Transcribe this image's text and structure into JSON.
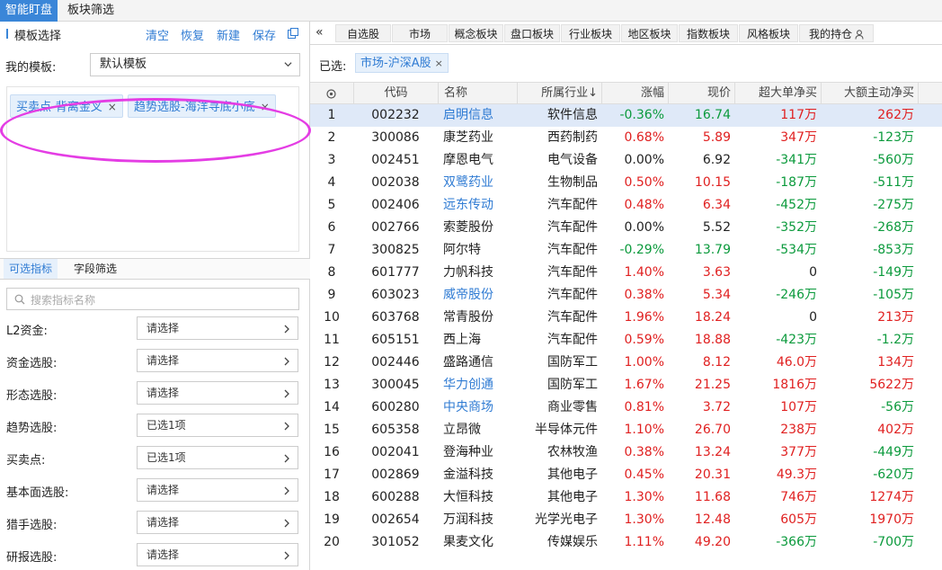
{
  "top_tabs": [
    "智能盯盘",
    "板块筛选"
  ],
  "template": {
    "title": "模板选择",
    "actions": [
      "清空",
      "恢复",
      "新建",
      "保存"
    ],
    "my_template_label": "我的模板:",
    "my_template_value": "默认模板",
    "tags": [
      "买卖点-背离金叉",
      "趋势选股-海洋寻底小底"
    ]
  },
  "sub_tabs": [
    "可选指标",
    "字段筛选"
  ],
  "search": {
    "placeholder": "搜索指标名称"
  },
  "filters": [
    {
      "label": "L2资金:",
      "value": "请选择"
    },
    {
      "label": "资金选股:",
      "value": "请选择"
    },
    {
      "label": "形态选股:",
      "value": "请选择"
    },
    {
      "label": "趋势选股:",
      "value": "已选1项"
    },
    {
      "label": "买卖点:",
      "value": "已选1项"
    },
    {
      "label": "基本面选股:",
      "value": "请选择"
    },
    {
      "label": "猎手选股:",
      "value": "请选择"
    },
    {
      "label": "研报选股:",
      "value": "请选择"
    }
  ],
  "market_tabs": [
    "自选股",
    "市场",
    "概念板块",
    "盘口板块",
    "行业板块",
    "地区板块",
    "指数板块",
    "风格板块",
    "我的持仓"
  ],
  "selected": {
    "label": "已选:",
    "tag": "市场-沪深A股"
  },
  "columns": [
    "代码",
    "名称",
    "所属行业↓",
    "涨幅",
    "现价",
    "超大单净买",
    "大额主动净买"
  ],
  "rows": [
    {
      "idx": "1",
      "code": "002232",
      "name": "启明信息",
      "industry": "软件信息",
      "chg": "-0.36%",
      "price": "16.74",
      "super": "117万",
      "big": "262万",
      "name_link": true,
      "chg_dir": "down",
      "price_dir": "down",
      "super_dir": "up",
      "big_dir": "up"
    },
    {
      "idx": "2",
      "code": "300086",
      "name": "康芝药业",
      "industry": "西药制药",
      "chg": "0.68%",
      "price": "5.89",
      "super": "347万",
      "big": "-123万",
      "name_link": false,
      "chg_dir": "up",
      "price_dir": "up",
      "super_dir": "up",
      "big_dir": "down"
    },
    {
      "idx": "3",
      "code": "002451",
      "name": "摩恩电气",
      "industry": "电气设备",
      "chg": "0.00%",
      "price": "6.92",
      "super": "-341万",
      "big": "-560万",
      "name_link": false,
      "chg_dir": "flat",
      "price_dir": "flat",
      "super_dir": "down",
      "big_dir": "down"
    },
    {
      "idx": "4",
      "code": "002038",
      "name": "双鹭药业",
      "industry": "生物制品",
      "chg": "0.50%",
      "price": "10.15",
      "super": "-187万",
      "big": "-511万",
      "name_link": true,
      "chg_dir": "up",
      "price_dir": "up",
      "super_dir": "down",
      "big_dir": "down"
    },
    {
      "idx": "5",
      "code": "002406",
      "name": "远东传动",
      "industry": "汽车配件",
      "chg": "0.48%",
      "price": "6.34",
      "super": "-452万",
      "big": "-275万",
      "name_link": true,
      "chg_dir": "up",
      "price_dir": "up",
      "super_dir": "down",
      "big_dir": "down"
    },
    {
      "idx": "6",
      "code": "002766",
      "name": "索菱股份",
      "industry": "汽车配件",
      "chg": "0.00%",
      "price": "5.52",
      "super": "-352万",
      "big": "-268万",
      "name_link": false,
      "chg_dir": "flat",
      "price_dir": "flat",
      "super_dir": "down",
      "big_dir": "down"
    },
    {
      "idx": "7",
      "code": "300825",
      "name": "阿尔特",
      "industry": "汽车配件",
      "chg": "-0.29%",
      "price": "13.79",
      "super": "-534万",
      "big": "-853万",
      "name_link": false,
      "chg_dir": "down",
      "price_dir": "down",
      "super_dir": "down",
      "big_dir": "down"
    },
    {
      "idx": "8",
      "code": "601777",
      "name": "力帆科技",
      "industry": "汽车配件",
      "chg": "1.40%",
      "price": "3.63",
      "super": "0",
      "big": "-149万",
      "name_link": false,
      "chg_dir": "up",
      "price_dir": "up",
      "super_dir": "flat",
      "big_dir": "down"
    },
    {
      "idx": "9",
      "code": "603023",
      "name": "威帝股份",
      "industry": "汽车配件",
      "chg": "0.38%",
      "price": "5.34",
      "super": "-246万",
      "big": "-105万",
      "name_link": true,
      "chg_dir": "up",
      "price_dir": "up",
      "super_dir": "down",
      "big_dir": "down"
    },
    {
      "idx": "10",
      "code": "603768",
      "name": "常青股份",
      "industry": "汽车配件",
      "chg": "1.96%",
      "price": "18.24",
      "super": "0",
      "big": "213万",
      "name_link": false,
      "chg_dir": "up",
      "price_dir": "up",
      "super_dir": "flat",
      "big_dir": "up"
    },
    {
      "idx": "11",
      "code": "605151",
      "name": "西上海",
      "industry": "汽车配件",
      "chg": "0.59%",
      "price": "18.88",
      "super": "-423万",
      "big": "-1.2万",
      "name_link": false,
      "chg_dir": "up",
      "price_dir": "up",
      "super_dir": "down",
      "big_dir": "down"
    },
    {
      "idx": "12",
      "code": "002446",
      "name": "盛路通信",
      "industry": "国防军工",
      "chg": "1.00%",
      "price": "8.12",
      "super": "46.0万",
      "big": "134万",
      "name_link": false,
      "chg_dir": "up",
      "price_dir": "up",
      "super_dir": "up",
      "big_dir": "up"
    },
    {
      "idx": "13",
      "code": "300045",
      "name": "华力创通",
      "industry": "国防军工",
      "chg": "1.67%",
      "price": "21.25",
      "super": "1816万",
      "big": "5622万",
      "name_link": true,
      "chg_dir": "up",
      "price_dir": "up",
      "super_dir": "up",
      "big_dir": "up"
    },
    {
      "idx": "14",
      "code": "600280",
      "name": "中央商场",
      "industry": "商业零售",
      "chg": "0.81%",
      "price": "3.72",
      "super": "107万",
      "big": "-56万",
      "name_link": true,
      "chg_dir": "up",
      "price_dir": "up",
      "super_dir": "up",
      "big_dir": "down"
    },
    {
      "idx": "15",
      "code": "605358",
      "name": "立昂微",
      "industry": "半导体元件",
      "chg": "1.10%",
      "price": "26.70",
      "super": "238万",
      "big": "402万",
      "name_link": false,
      "chg_dir": "up",
      "price_dir": "up",
      "super_dir": "up",
      "big_dir": "up"
    },
    {
      "idx": "16",
      "code": "002041",
      "name": "登海种业",
      "industry": "农林牧渔",
      "chg": "0.38%",
      "price": "13.24",
      "super": "377万",
      "big": "-449万",
      "name_link": false,
      "chg_dir": "up",
      "price_dir": "up",
      "super_dir": "up",
      "big_dir": "down"
    },
    {
      "idx": "17",
      "code": "002869",
      "name": "金溢科技",
      "industry": "其他电子",
      "chg": "0.45%",
      "price": "20.31",
      "super": "49.3万",
      "big": "-620万",
      "name_link": false,
      "chg_dir": "up",
      "price_dir": "up",
      "super_dir": "up",
      "big_dir": "down"
    },
    {
      "idx": "18",
      "code": "600288",
      "name": "大恒科技",
      "industry": "其他电子",
      "chg": "1.30%",
      "price": "11.68",
      "super": "746万",
      "big": "1274万",
      "name_link": false,
      "chg_dir": "up",
      "price_dir": "up",
      "super_dir": "up",
      "big_dir": "up"
    },
    {
      "idx": "19",
      "code": "002654",
      "name": "万润科技",
      "industry": "光学光电子",
      "chg": "1.30%",
      "price": "12.48",
      "super": "605万",
      "big": "1970万",
      "name_link": false,
      "chg_dir": "up",
      "price_dir": "up",
      "super_dir": "up",
      "big_dir": "up"
    },
    {
      "idx": "20",
      "code": "301052",
      "name": "果麦文化",
      "industry": "传媒娱乐",
      "chg": "1.11%",
      "price": "49.20",
      "super": "-366万",
      "big": "-700万",
      "name_link": false,
      "chg_dir": "up",
      "price_dir": "up",
      "super_dir": "down",
      "big_dir": "down"
    }
  ],
  "colors": {
    "accent": "#2f7bd3",
    "up": "#e02020",
    "down": "#0b9a3c",
    "highlight": "#e43de4"
  }
}
